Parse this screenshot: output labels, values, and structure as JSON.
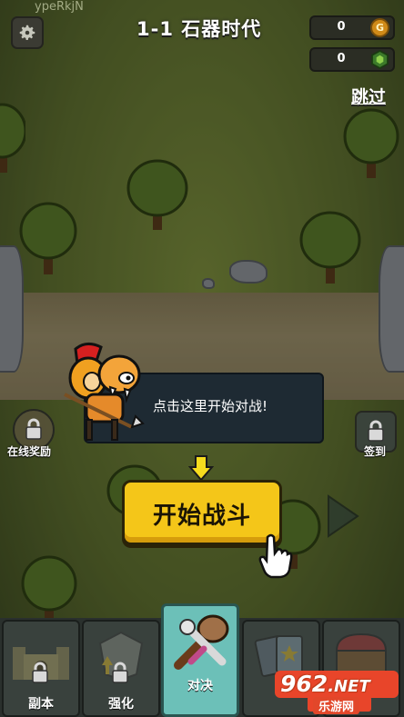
{
  "watermark": "ypeRkjN",
  "header": {
    "level_title": "1-1 石器时代",
    "gold_value": "0",
    "gold_icon_label": "G",
    "gem_value": "0"
  },
  "skip_label": "跳过",
  "tutorial": {
    "tooltip_text": "点击这里开始对战!"
  },
  "side_buttons": {
    "online_reward_label": "在线奖励",
    "checkin_label": "签到"
  },
  "start_button_label": "开始战斗",
  "bottom_nav": {
    "items": [
      {
        "label": "副本",
        "icon": "castle-icon",
        "locked": true
      },
      {
        "label": "强化",
        "icon": "upgrade-icon",
        "locked": true
      },
      {
        "label": "对决",
        "icon": "club-weapon-icon",
        "locked": false
      },
      {
        "label": "",
        "icon": "cards-icon",
        "locked": true
      },
      {
        "label": "",
        "icon": "chest-icon",
        "locked": true
      }
    ]
  },
  "site_logo": {
    "number": "962",
    "suffix": ".NET",
    "tagline": "乐游网"
  },
  "colors": {
    "start_button": "#f4c619",
    "active_tab": "#6cc0b8",
    "tooltip_bg": "#1e2a33"
  }
}
